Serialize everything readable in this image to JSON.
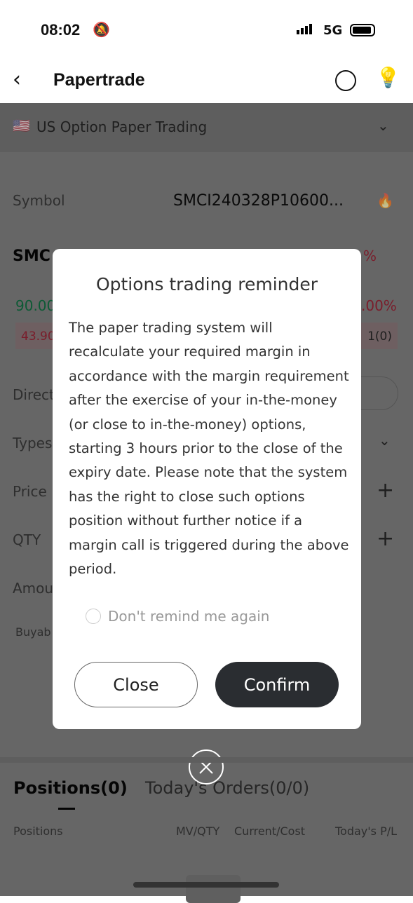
{
  "status_bar": {
    "time": "08:02",
    "network": "5G"
  },
  "header": {
    "title": "Papertrade"
  },
  "account": {
    "label": "US Option Paper Trading"
  },
  "form": {
    "symbol_label": "Symbol",
    "symbol_value": "SMCI240328P10600...",
    "name_partial": "SMC",
    "change_pct": "%",
    "bid_partial": "90.00",
    "pct_partial": ".00%",
    "ask_partial": "43.90",
    "qty_partial": "1(0)",
    "direction_label": "Direct",
    "types_label": "Types",
    "price_label": "Price",
    "qty_label": "QTY",
    "amount_label": "Amou",
    "buyable_label": "Buyab"
  },
  "tabs": [
    {
      "label": "Positions(0)"
    },
    {
      "label": "Today's Orders(0/0)"
    }
  ],
  "columns": [
    "Positions",
    "MV/QTY",
    "Current/Cost",
    "Today's P/L"
  ],
  "modal": {
    "title": "Options trading reminder",
    "body": "The paper trading system will recalculate your required margin in accordance with the margin requirement after the exercise of your in-the-money (or close to in-the-money) options, starting 3 hours prior to the close of the expiry date. Please note that the system has the right to close such options position without further notice if a margin call is triggered during the above period.",
    "checkbox_label": "Don't remind me again",
    "checkbox_checked": false,
    "close_label": "Close",
    "confirm_label": "Confirm"
  },
  "colors": {
    "green": "#1a9a5a",
    "red": "#d0304a",
    "dark_button": "#2a2d31"
  }
}
